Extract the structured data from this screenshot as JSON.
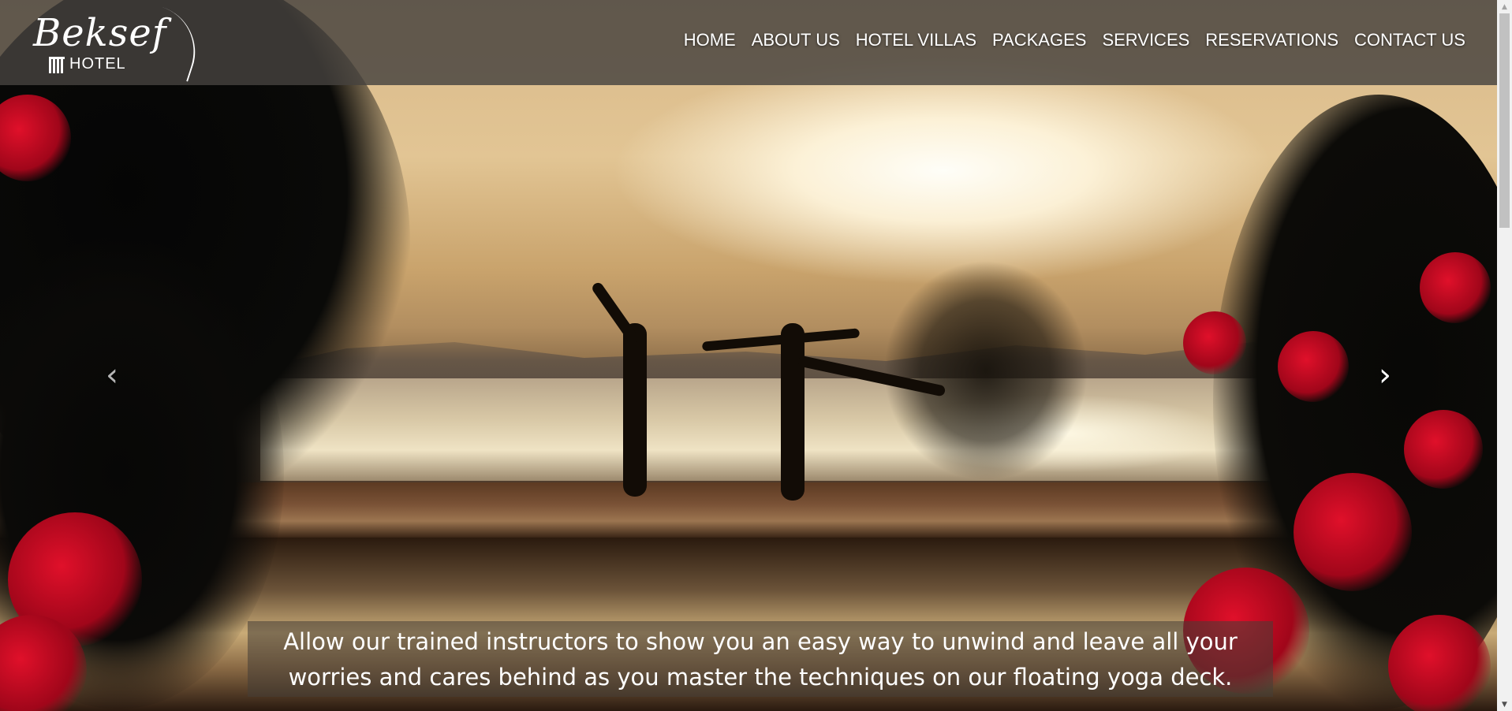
{
  "brand": {
    "script_name": "Beksef",
    "subtitle": "HOTEL"
  },
  "nav": {
    "items": [
      {
        "label": "HOME"
      },
      {
        "label": "ABOUT US"
      },
      {
        "label": "HOTEL VILLAS"
      },
      {
        "label": "PACKAGES"
      },
      {
        "label": "SERVICES"
      },
      {
        "label": "RESERVATIONS"
      },
      {
        "label": "CONTACT US"
      }
    ]
  },
  "carousel": {
    "prev_icon": "chevron-left-icon",
    "next_icon": "chevron-right-icon",
    "prev_glyph": "‹",
    "next_glyph": "›",
    "caption_line1": "Allow our trained instructors to show you an easy way to unwind and leave all your",
    "caption_line2": "worries and cares behind as you master the techniques on our floating yoga deck."
  },
  "scrollbar": {
    "up_glyph": "▲",
    "down_glyph": "▼"
  },
  "colors": {
    "header_bg": "#46423e",
    "nav_text": "#ffffff",
    "flower_red": "#d0102a"
  }
}
